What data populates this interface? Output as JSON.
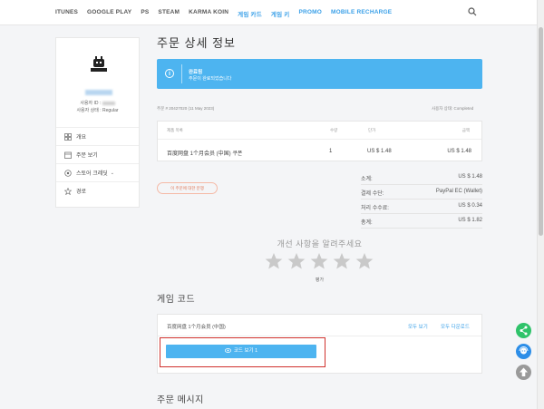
{
  "nav": {
    "items": [
      "ITUNES",
      "GOOGLE PLAY",
      "PS",
      "STEAM",
      "KARMA KOIN",
      "게임 카드",
      "게임 키",
      "PROMO",
      "MOBILE RECHARGE"
    ]
  },
  "sidebar": {
    "user_id_label": "사용자 ID :",
    "user_status_label": "사용자 상태 : Regular",
    "menu": [
      "개요",
      "주문 보기",
      "스토어 크레딧",
      "경로"
    ]
  },
  "main": {
    "title": "주문 상세 정보",
    "banner": {
      "title": "완료됨",
      "subtitle": "주문이 완료되었습니다"
    },
    "order_no": "주문 # 20427020 (11 May 2023)",
    "use_state": "사용자 상태: Completed",
    "table": {
      "headers": {
        "product": "제품 목록",
        "qty": "수량",
        "price": "단가",
        "amount": "금액"
      },
      "row": {
        "product": "百度网盘 1个月会员 (中国) 쿠폰",
        "qty": "1",
        "price": "US $ 1.48",
        "amount": "US $ 1.48"
      }
    },
    "dispute": "이 주문에 대한 분쟁",
    "summary": [
      {
        "label": "소계:",
        "value": "US $ 1.48"
      },
      {
        "label": "결제 수단:",
        "value": "PayPal EC (Wallet)"
      },
      {
        "label": "처리 수수료:",
        "value": "US $ 0.34"
      },
      {
        "label": "총계:",
        "value": "US $ 1.82"
      }
    ],
    "feedback": "개선 사항을 알려주세요",
    "rating_label": "평가",
    "rating_value": 0,
    "game_code": {
      "title": "게임 코드",
      "product": "百度网盘 1个月会员 (中国)",
      "view_all": "모두 보기",
      "download_all": "모두 다운로드",
      "view_code": "코드 보기 1"
    },
    "message_title": "주문 메시지"
  },
  "colors": {
    "accent": "#4db4f0",
    "link": "#3aa0e8",
    "highlight_box": "#d0312d",
    "share": "#2fc36a",
    "support": "#2d8ee8",
    "top": "#9a9a9a"
  }
}
